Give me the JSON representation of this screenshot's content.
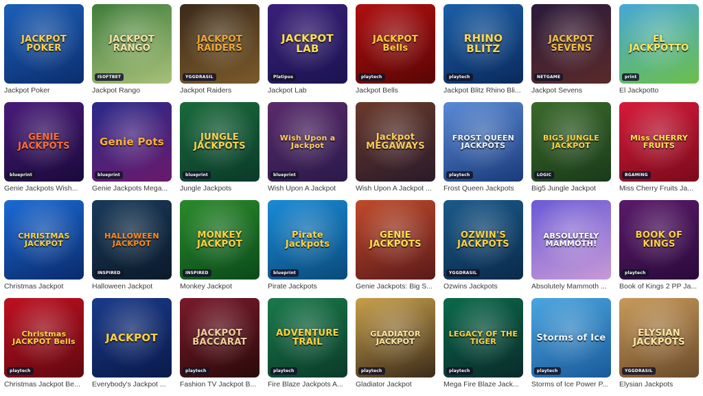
{
  "games": [
    {
      "title": "Jackpot Poker",
      "logo": "JACKPOT POKER",
      "provider": "",
      "colors": [
        "#1b5fb8",
        "#0c2e6e"
      ],
      "logo_color": "#ffd23f"
    },
    {
      "title": "Jackpot Rango",
      "logo": "JACKPOT RANGO",
      "provider": "ISOFTBET",
      "colors": [
        "#3f7d3a",
        "#a8c07a"
      ],
      "logo_color": "#f1e3a0"
    },
    {
      "title": "Jackpot Raiders",
      "logo": "JACKPOT RAIDERS",
      "provider": "YGGDRASIL",
      "colors": [
        "#3b2a1a",
        "#7a5a2a"
      ],
      "logo_color": "#f0a830"
    },
    {
      "title": "Jackpot Lab",
      "logo": "JACKPOT LAB",
      "provider": "Platipus",
      "colors": [
        "#3a1f7a",
        "#1b1450"
      ],
      "logo_color": "#ffe14a"
    },
    {
      "title": "Jackpot Bells",
      "logo": "JACKPOT Bells",
      "provider": "playtech",
      "colors": [
        "#b01010",
        "#5a0505"
      ],
      "logo_color": "#ffcc33"
    },
    {
      "title": "Jackpot Blitz Rhino Bli...",
      "logo": "RHINO BLITZ",
      "provider": "playtech",
      "colors": [
        "#1a5fa8",
        "#0a2a5c"
      ],
      "logo_color": "#ffd84a"
    },
    {
      "title": "Jackpot Sevens",
      "logo": "JACKPOT SEVENS",
      "provider": "NETGAME",
      "colors": [
        "#2a1a3a",
        "#5a2a2a"
      ],
      "logo_color": "#f4c042"
    },
    {
      "title": "El Jackpotto",
      "logo": "EL JACKPOTTO",
      "provider": "print",
      "colors": [
        "#46a7d6",
        "#6cbf4a"
      ],
      "logo_color": "#ffe85a"
    },
    {
      "title": "Genie Jackpots Wish...",
      "logo": "GENIE JACKPOTS",
      "provider": "blueprint",
      "colors": [
        "#4a1a7a",
        "#1a0a3a"
      ],
      "logo_color": "#ff6a3a"
    },
    {
      "title": "Genie Jackpots Mega...",
      "logo": "Genie Pots",
      "provider": "blueprint",
      "colors": [
        "#2a2a8a",
        "#6a1a6a"
      ],
      "logo_color": "#ffb03a"
    },
    {
      "title": "Jungle Jackpots",
      "logo": "JUNGLE JACKPOTS",
      "provider": "blueprint",
      "colors": [
        "#1a6a3a",
        "#0a3a2a"
      ],
      "logo_color": "#f7d54a"
    },
    {
      "title": "Wish Upon A Jackpot",
      "logo": "Wish Upon a Jackpot",
      "provider": "blueprint",
      "colors": [
        "#5a2a6a",
        "#2a1a4a"
      ],
      "logo_color": "#ffcc5a"
    },
    {
      "title": "Wish Upon A Jackpot ...",
      "logo": "Jackpot MEGAWAYS",
      "provider": "",
      "colors": [
        "#6a3a2a",
        "#2a1a2a"
      ],
      "logo_color": "#ffcc5a"
    },
    {
      "title": "Frost Queen Jackpots",
      "logo": "FROST QUEEN JACKPOTS",
      "provider": "playtech",
      "colors": [
        "#5a8ad6",
        "#1a3a7a"
      ],
      "logo_color": "#e8f4ff"
    },
    {
      "title": "Big5 Jungle Jackpot",
      "logo": "BIG5 JUNGLE JACKPOT",
      "provider": "LOGIC",
      "colors": [
        "#3a6a2a",
        "#1a3a1a"
      ],
      "logo_color": "#ffd23a"
    },
    {
      "title": "Miss Cherry Fruits Ja...",
      "logo": "Miss CHERRY FRUITS",
      "provider": "BGAMING",
      "colors": [
        "#d61a3a",
        "#7a0a1a"
      ],
      "logo_color": "#ffe14a"
    },
    {
      "title": "Christmas Jackpot",
      "logo": "CHRISTMAS JACKPOT",
      "provider": "",
      "colors": [
        "#1a6ad6",
        "#0a2a6a"
      ],
      "logo_color": "#ffd23a"
    },
    {
      "title": "Halloween Jackpot",
      "logo": "HALLOWEEN JACKPOT",
      "provider": "INSPIRED",
      "colors": [
        "#1a3a5a",
        "#0a1a2a"
      ],
      "logo_color": "#ff8a1a"
    },
    {
      "title": "Monkey Jackpot",
      "logo": "MONKEY JACKPOT",
      "provider": "INSPIRED",
      "colors": [
        "#2a8a2a",
        "#0a4a1a"
      ],
      "logo_color": "#ffd23a"
    },
    {
      "title": "Pirate Jackpots",
      "logo": "Pirate Jackpots",
      "provider": "blueprint",
      "colors": [
        "#1a8ad6",
        "#0a4a7a"
      ],
      "logo_color": "#ffd23a"
    },
    {
      "title": "Genie Jackpots: Big S...",
      "logo": "GENIE JACKPOTS",
      "provider": "",
      "colors": [
        "#c04a2a",
        "#5a1a1a"
      ],
      "logo_color": "#ffe14a"
    },
    {
      "title": "Ozwins Jackpots",
      "logo": "OZWIN'S JACKPOTS",
      "provider": "YGGDRASIL",
      "colors": [
        "#1a5a8a",
        "#0a2a4a"
      ],
      "logo_color": "#ffd23a"
    },
    {
      "title": "Absolutely Mammoth ...",
      "logo": "ABSOLUTELY MAMMOTH!",
      "provider": "",
      "colors": [
        "#6a5ad6",
        "#c89ad6"
      ],
      "logo_color": "#ffffff"
    },
    {
      "title": "Book of Kings 2 PP Ja...",
      "logo": "BOOK OF KINGS",
      "provider": "playtech",
      "colors": [
        "#5a1a6a",
        "#2a0a3a"
      ],
      "logo_color": "#ffd23a"
    },
    {
      "title": "Christmas Jackpot Be...",
      "logo": "Christmas JACKPOT Bells",
      "provider": "playtech",
      "colors": [
        "#c01020",
        "#600810"
      ],
      "logo_color": "#ffd23a"
    },
    {
      "title": "Everybody's Jackpot ...",
      "logo": "JACKPOT",
      "provider": "",
      "colors": [
        "#1a3a8a",
        "#0a1a4a"
      ],
      "logo_color": "#ffd23a"
    },
    {
      "title": "Fashion TV Jackpot B...",
      "logo": "JACKPOT BACCARAT",
      "provider": "playtech",
      "colors": [
        "#7a1a2a",
        "#2a0a0a"
      ],
      "logo_color": "#f4d09a"
    },
    {
      "title": "Fire Blaze Jackpots A...",
      "logo": "ADVENTURE TRAIL",
      "provider": "playtech",
      "colors": [
        "#1a7a4a",
        "#0a3a2a"
      ],
      "logo_color": "#ffd23a"
    },
    {
      "title": "Gladiator Jackpot",
      "logo": "GLADIATOR JACKPOT",
      "provider": "playtech",
      "colors": [
        "#c8a04a",
        "#3a2a1a"
      ],
      "logo_color": "#ffe7a0"
    },
    {
      "title": "Mega Fire Blaze Jack...",
      "logo": "LEGACY OF THE TIGER",
      "provider": "playtech",
      "colors": [
        "#0a6a4a",
        "#0a2a2a"
      ],
      "logo_color": "#ffd23a"
    },
    {
      "title": "Storms of Ice Power P...",
      "logo": "Storms of Ice",
      "provider": "playtech",
      "colors": [
        "#4aa6e0",
        "#1a5a9a"
      ],
      "logo_color": "#e8f6ff"
    },
    {
      "title": "Elysian Jackpots",
      "logo": "ELYSIAN JACKPOTS",
      "provider": "YGGDRASIL",
      "colors": [
        "#c89a5a",
        "#6a4a2a"
      ],
      "logo_color": "#ffe7a0"
    }
  ]
}
